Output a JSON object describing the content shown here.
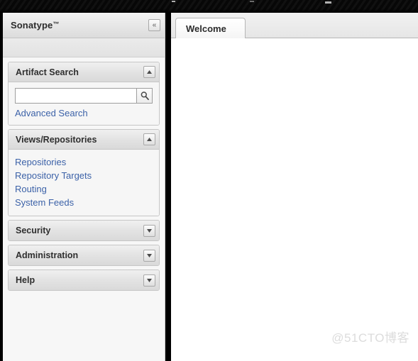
{
  "window": {
    "top_bar_style": "dark-striped"
  },
  "sidebar": {
    "brand": {
      "title": "Sonatype",
      "trademark": "™",
      "collapse_label": "«"
    },
    "panels": [
      {
        "id": "artifact-search",
        "title": "Artifact Search",
        "state": "expanded",
        "toggle_icon": "chevron-up-icon",
        "search": {
          "value": "",
          "placeholder": "",
          "button_icon": "search-icon"
        },
        "advanced_link": "Advanced Search"
      },
      {
        "id": "views-repositories",
        "title": "Views/Repositories",
        "state": "expanded",
        "toggle_icon": "chevron-up-icon",
        "links": [
          "Repositories",
          "Repository Targets",
          "Routing",
          "System Feeds"
        ]
      },
      {
        "id": "security",
        "title": "Security",
        "state": "collapsed",
        "toggle_icon": "chevron-down-icon"
      },
      {
        "id": "administration",
        "title": "Administration",
        "state": "collapsed",
        "toggle_icon": "chevron-down-icon"
      },
      {
        "id": "help",
        "title": "Help",
        "state": "collapsed",
        "toggle_icon": "chevron-down-icon"
      }
    ]
  },
  "main": {
    "tabs": [
      {
        "label": "Welcome",
        "active": true
      }
    ],
    "content": ""
  },
  "watermark": "@51CTO博客",
  "colors": {
    "link": "#3c62a8",
    "panel_header_text": "#2f2f2f",
    "divider": "#000000",
    "content_bg": "#ffffff",
    "sidebar_bg": "#f7f7f7",
    "watermark": "#dcdcdc"
  }
}
